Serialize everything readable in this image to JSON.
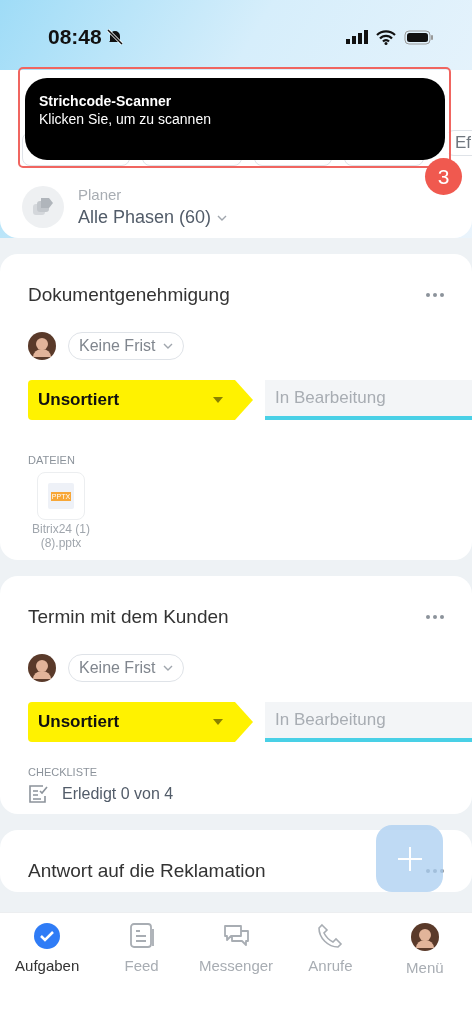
{
  "status_bar": {
    "time": "08:48",
    "muted": true
  },
  "filters": {
    "cut_chip": "Ef"
  },
  "tooltip": {
    "title": "Strichcode-Scanner",
    "text": "Klicken Sie, um zu scannen",
    "step": "3"
  },
  "planner": {
    "label": "Planer",
    "value": "Alle Phasen",
    "count": "(60)"
  },
  "tasks": [
    {
      "title": "Dokumentgenehmigung",
      "deadline": "Keine Frist",
      "stage": "Unsortiert",
      "next_stage": "In Bearbeitung",
      "section": {
        "kind": "files",
        "label": "DATEIEN",
        "files": [
          {
            "name": "Bitrix24 (1) (8).pptx",
            "badge": "PPTX"
          }
        ]
      }
    },
    {
      "title": "Termin mit dem Kunden",
      "deadline": "Keine Frist",
      "stage": "Unsortiert",
      "next_stage": "In Bearbeitung",
      "section": {
        "kind": "checklist",
        "label": "CHECKLISTE",
        "text": "Erledigt 0 von 4"
      }
    },
    {
      "title": "Antwort auf die Reklamation"
    }
  ],
  "tabs": [
    {
      "label": "Aufgaben",
      "kind": "tasks",
      "selected": true
    },
    {
      "label": "Feed",
      "kind": "feed",
      "selected": false
    },
    {
      "label": "Messenger",
      "kind": "messenger",
      "selected": false
    },
    {
      "label": "Anrufe",
      "kind": "calls",
      "selected": false
    },
    {
      "label": "Menü",
      "kind": "menu",
      "selected": false
    }
  ]
}
